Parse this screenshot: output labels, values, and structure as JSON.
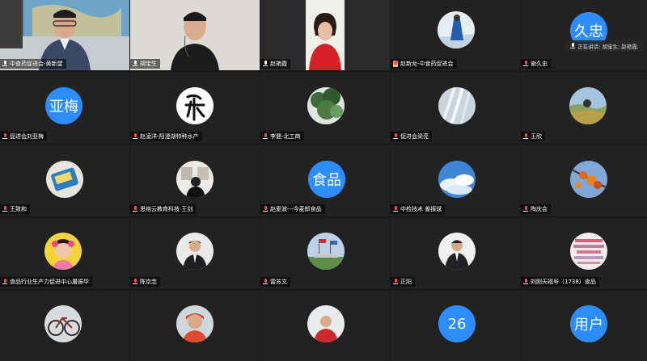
{
  "meeting": {
    "speaking_indicator": "正在讲话: 胡宝生; 赵艳霞;"
  },
  "participants": [
    {
      "name": "中食药促进会-黄新望",
      "type": "video"
    },
    {
      "name": "胡宝生",
      "type": "video",
      "active": true
    },
    {
      "name": "赵艳霞",
      "type": "video"
    },
    {
      "name": "赵新龙-中食药促进会",
      "type": "avatar"
    },
    {
      "name": "谢久忠",
      "type": "letters",
      "letters": "久忠"
    },
    {
      "name": "促进会刘亚梅",
      "type": "letters",
      "letters": "亚梅"
    },
    {
      "name": "赵凌洋-阳澄湖特种水产",
      "type": "avatar"
    },
    {
      "name": "李健-北工商",
      "type": "avatar"
    },
    {
      "name": "促进会梁亮",
      "type": "avatar"
    },
    {
      "name": "王欣",
      "type": "avatar"
    },
    {
      "name": "王致和",
      "type": "avatar"
    },
    {
      "name": "思络云教育科技 王剑",
      "type": "avatar"
    },
    {
      "name": "赵爱波---今麦郎食品",
      "type": "letters",
      "letters": "食品"
    },
    {
      "name": "中检技术 姜振斌",
      "type": "avatar"
    },
    {
      "name": "陶庆会",
      "type": "avatar"
    },
    {
      "name": "食品行业生产力促进中心屠振华",
      "type": "avatar"
    },
    {
      "name": "陈京念",
      "type": "avatar"
    },
    {
      "name": "雷苏文",
      "type": "avatar"
    },
    {
      "name": "正阳",
      "type": "avatar"
    },
    {
      "name": "刘刚天福号（1738）食品",
      "type": "avatar"
    },
    {
      "name": "",
      "type": "avatar"
    },
    {
      "name": "",
      "type": "avatar"
    },
    {
      "name": "",
      "type": "avatar"
    },
    {
      "name": "",
      "type": "letters",
      "letters": "26"
    },
    {
      "name": "",
      "type": "letters",
      "letters": "用户"
    }
  ],
  "colors": {
    "tile_bg": "#222222",
    "avatar_blue": "#2d8cff",
    "active_border": "#2fd52f",
    "page_bg": "#1a1a1a"
  }
}
